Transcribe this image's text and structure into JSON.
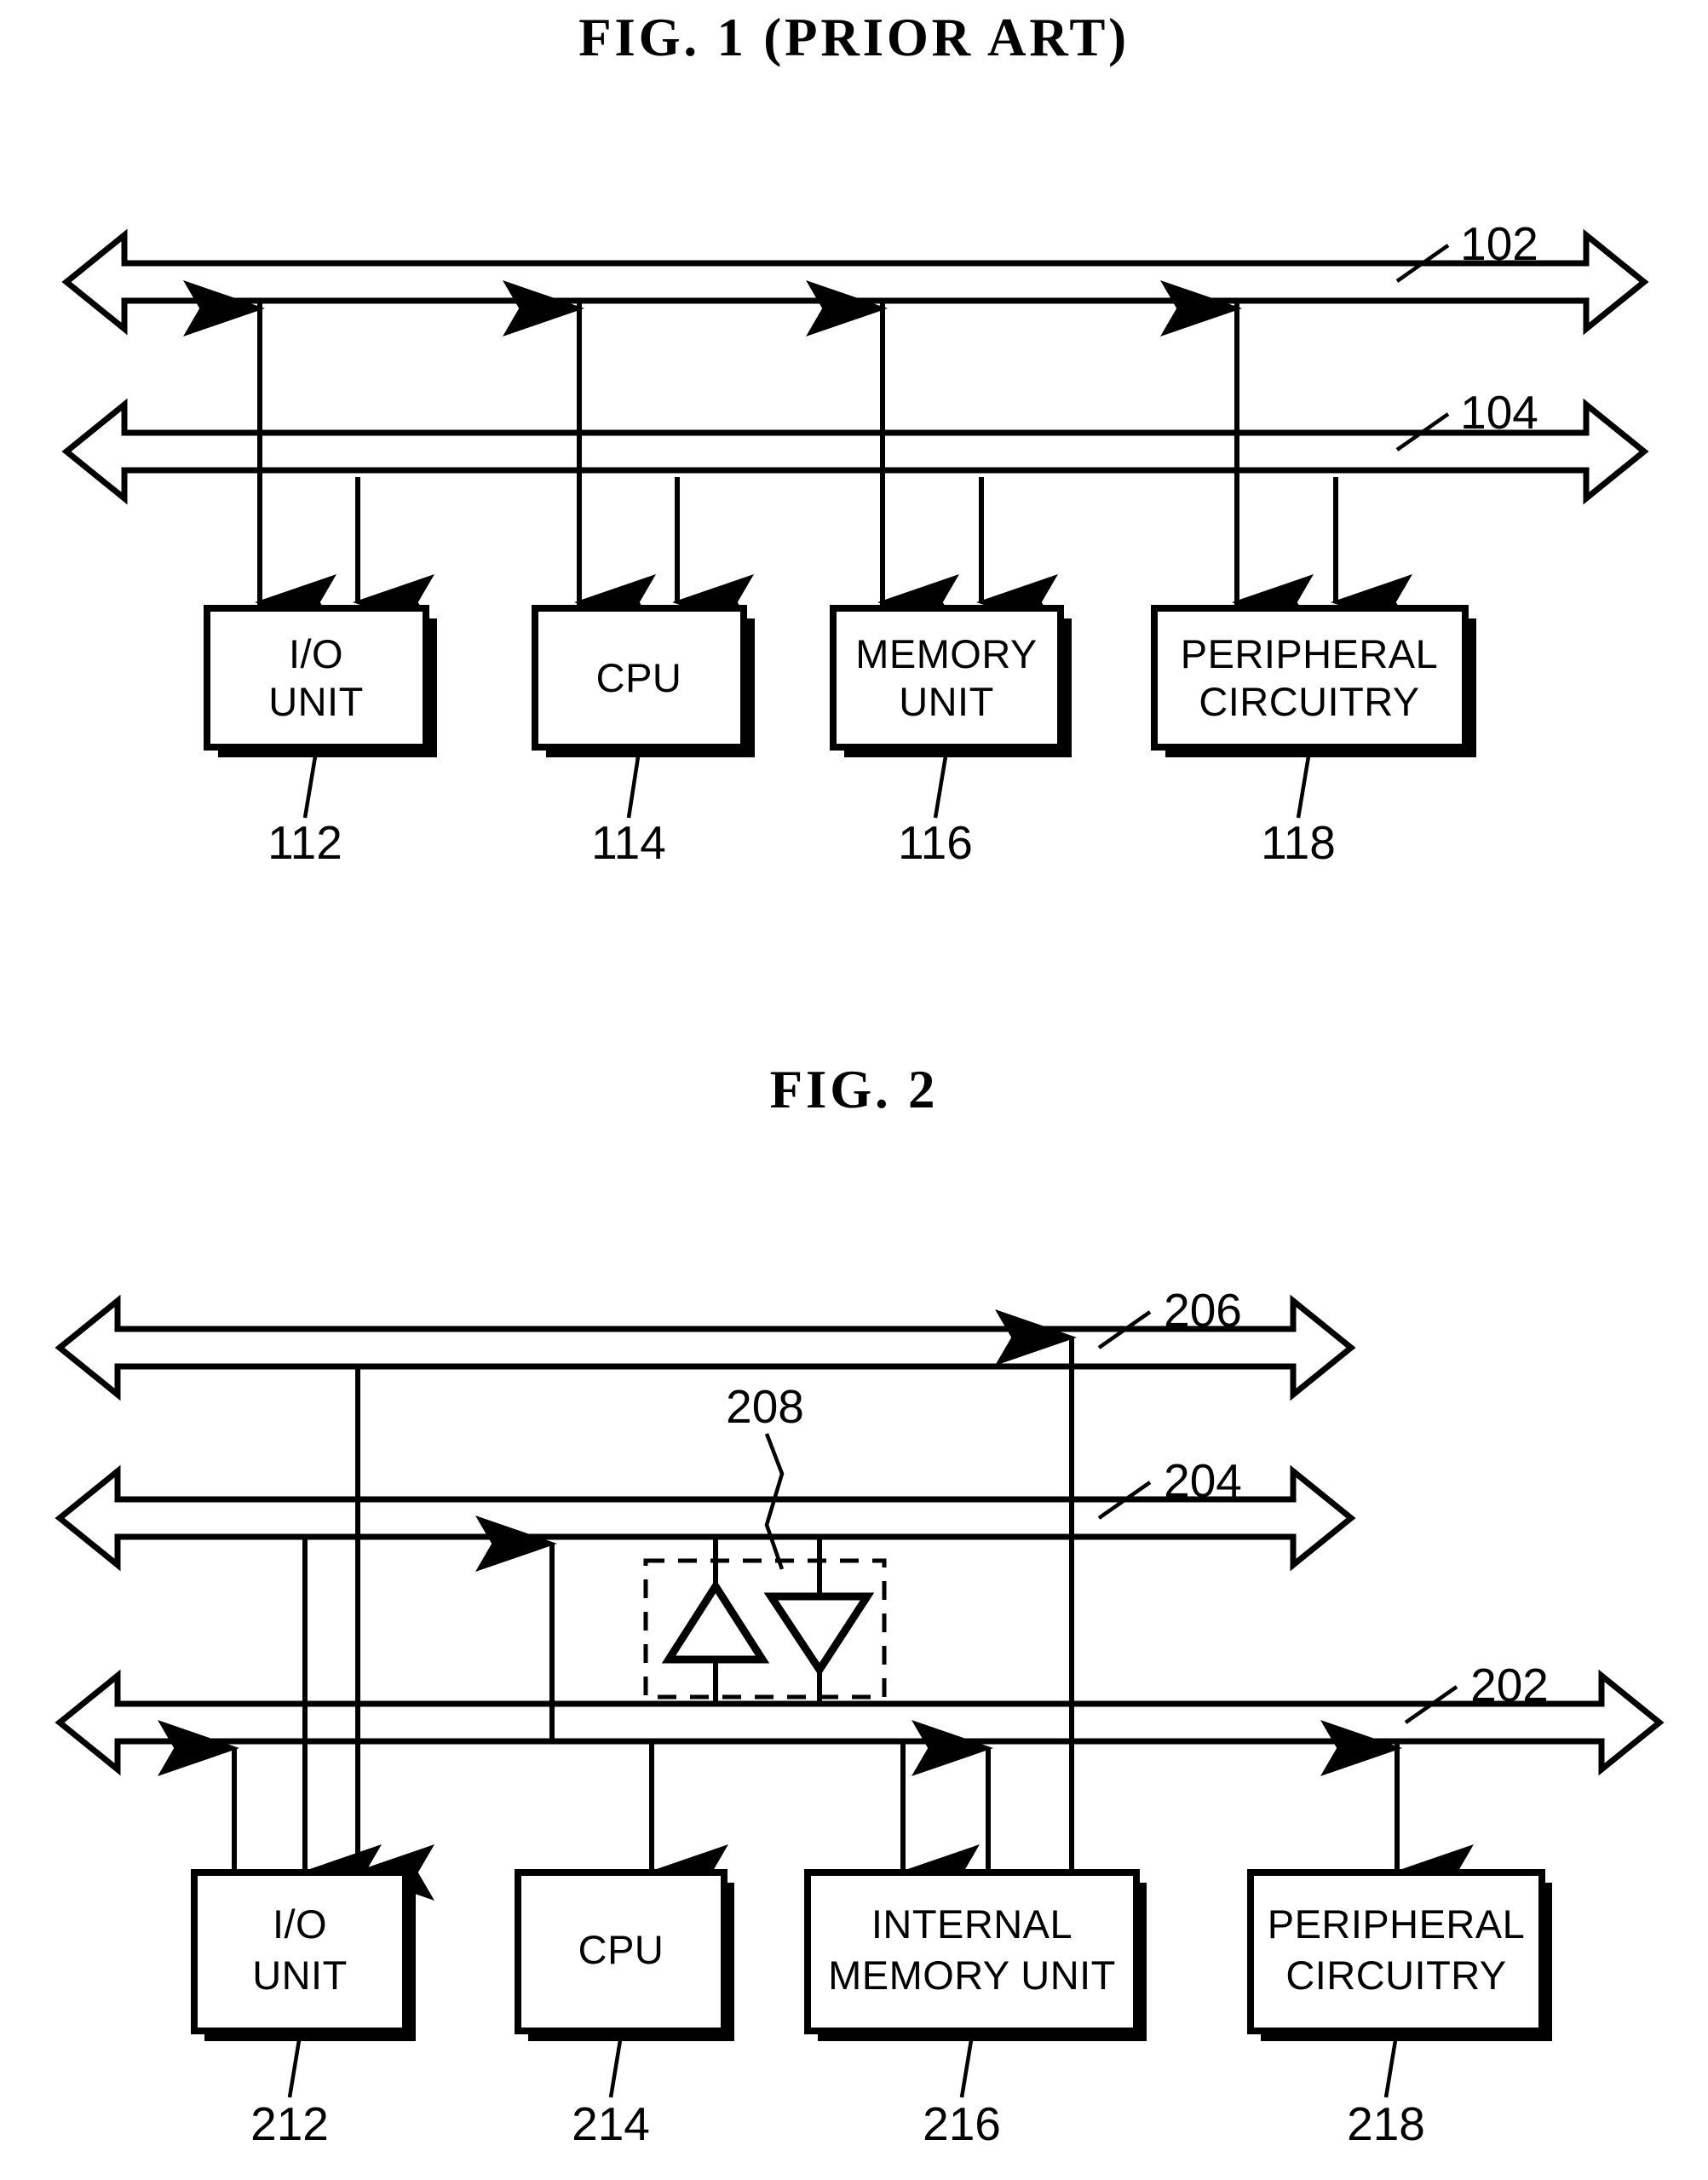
{
  "figures": [
    {
      "id": "fig1",
      "title": "FIG. 1 (PRIOR ART)",
      "buses": [
        {
          "ref": "102",
          "name": "upper-bus"
        },
        {
          "ref": "104",
          "name": "lower-bus"
        }
      ],
      "blocks": [
        {
          "ref": "112",
          "lines": [
            "I/O",
            "UNIT"
          ]
        },
        {
          "ref": "114",
          "lines": [
            "CPU"
          ]
        },
        {
          "ref": "116",
          "lines": [
            "MEMORY",
            "UNIT"
          ]
        },
        {
          "ref": "118",
          "lines": [
            "PERIPHERAL",
            "CIRCUITRY"
          ]
        }
      ]
    },
    {
      "id": "fig2",
      "title": "FIG. 2",
      "buses": [
        {
          "ref": "206",
          "name": "top-bus"
        },
        {
          "ref": "204",
          "name": "middle-bus"
        },
        {
          "ref": "202",
          "name": "bottom-bus"
        }
      ],
      "buffer_block": {
        "ref": "208",
        "name": "bidirectional-buffer"
      },
      "blocks": [
        {
          "ref": "212",
          "lines": [
            "I/O",
            "UNIT"
          ]
        },
        {
          "ref": "214",
          "lines": [
            "CPU"
          ]
        },
        {
          "ref": "216",
          "lines": [
            "INTERNAL",
            "MEMORY UNIT"
          ]
        },
        {
          "ref": "218",
          "lines": [
            "PERIPHERAL",
            "CIRCUITRY"
          ]
        }
      ]
    }
  ],
  "colors": {
    "ink": "#000000",
    "paper": "#ffffff"
  }
}
